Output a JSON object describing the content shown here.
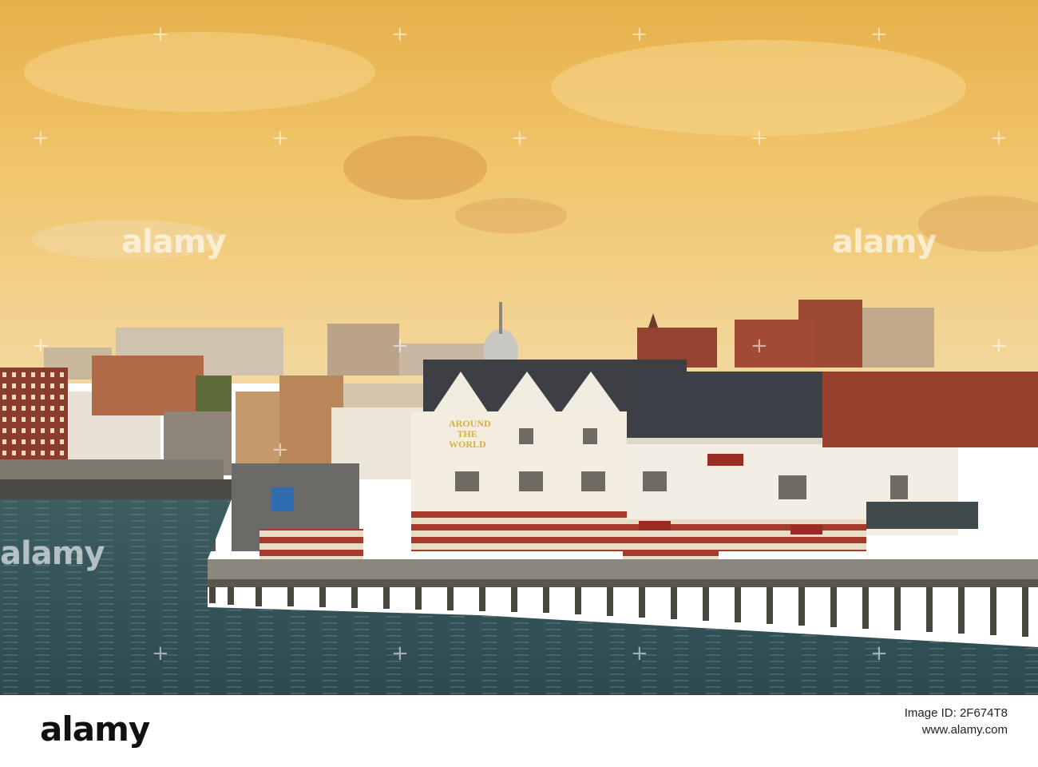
{
  "watermark": {
    "text": "alamy",
    "marks": [
      "+",
      "+",
      "+",
      "+",
      "+",
      "+",
      "+",
      "+",
      "+",
      "+",
      "+",
      "+",
      "+",
      "+",
      "+",
      "+",
      "+",
      "+"
    ]
  },
  "building_sign": {
    "line1": "AROUND",
    "line2": "THE",
    "line3": "WORLD"
  },
  "footer": {
    "logo": "alamy",
    "image_id_label": "Image ID: 2F674T8",
    "url": "www.alamy.com"
  },
  "colors": {
    "sky_top": "#e8b64a",
    "sky_mid": "#f0c468",
    "water": "#35545a",
    "brick": "#8a3a2a",
    "stripe_red": "#a8392c"
  }
}
